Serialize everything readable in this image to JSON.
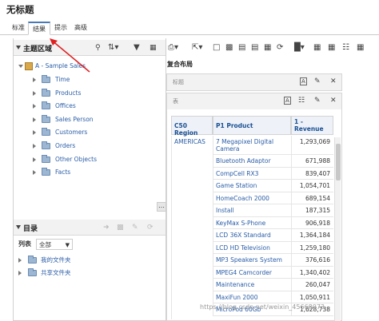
{
  "window": {
    "title": "无标题"
  },
  "tabs": [
    {
      "label": "标准"
    },
    {
      "label": "结果"
    },
    {
      "label": "提示"
    },
    {
      "label": "高级"
    }
  ],
  "subject_area": {
    "title": "主题区域",
    "root": "A - Sample Sales",
    "folders": [
      "Time",
      "Products",
      "Offices",
      "Sales Person",
      "Customers",
      "Orders",
      "Other Objects",
      "Facts"
    ]
  },
  "catalog": {
    "title": "目录",
    "view_label": "列表",
    "view_value": "全部",
    "items": [
      "我的文件夹",
      "共享文件夹"
    ]
  },
  "results": {
    "compound_label": "复合布局",
    "title_view": "标题",
    "table_view": "表",
    "columns": [
      "C50 Region",
      "P1 Product",
      "1 - Revenue"
    ],
    "region": "AMERICAS",
    "rows": [
      {
        "product": "7 Megapixel Digital Camera",
        "revenue": "1,293,069"
      },
      {
        "product": "Bluetooth Adaptor",
        "revenue": "671,988"
      },
      {
        "product": "CompCell RX3",
        "revenue": "839,407"
      },
      {
        "product": "Game Station",
        "revenue": "1,054,701"
      },
      {
        "product": "HomeCoach 2000",
        "revenue": "689,154"
      },
      {
        "product": "Install",
        "revenue": "187,315"
      },
      {
        "product": "KeyMax S-Phone",
        "revenue": "906,918"
      },
      {
        "product": "LCD 36X Standard",
        "revenue": "1,364,184"
      },
      {
        "product": "LCD HD Television",
        "revenue": "1,259,180"
      },
      {
        "product": "MP3 Speakers System",
        "revenue": "376,616"
      },
      {
        "product": "MPEG4 Camcorder",
        "revenue": "1,340,402"
      },
      {
        "product": "Maintenance",
        "revenue": "260,047"
      },
      {
        "product": "MaxiFun 2000",
        "revenue": "1,050,911"
      },
      {
        "product": "MicroPod 60Gb",
        "revenue": "1,628,738"
      }
    ]
  },
  "watermark": "https://blog.csdn.net/weixin_45668073",
  "colors": {
    "accent": "#4a7ab5",
    "link": "#2b5ea7",
    "arrow": "#e02020"
  }
}
